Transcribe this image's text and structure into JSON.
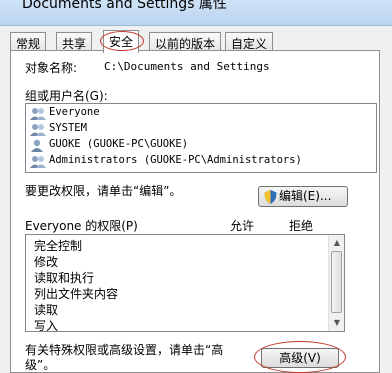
{
  "window": {
    "title": "Documents and Settings 属性"
  },
  "tabs": [
    {
      "label": "常规"
    },
    {
      "label": "共享"
    },
    {
      "label": "安全",
      "active": true
    },
    {
      "label": "以前的版本"
    },
    {
      "label": "自定义"
    }
  ],
  "security": {
    "object_name_label": "对象名称:",
    "object_name_value": "C:\\Documents and Settings",
    "groups_label": "组或用户名(G):",
    "users": [
      {
        "name": "Everyone",
        "icon": "users-group-icon"
      },
      {
        "name": "SYSTEM",
        "icon": "users-group-icon"
      },
      {
        "name": "GUOKE (GUOKE-PC\\GUOKE)",
        "icon": "user-icon"
      },
      {
        "name": "Administrators (GUOKE-PC\\Administrators)",
        "icon": "users-group-icon"
      }
    ],
    "edit_hint": "要更改权限，请单击“编辑”。",
    "edit_button": "编辑(E)...",
    "permissions_for": "Everyone 的权限(P)",
    "col_allow": "允许",
    "col_deny": "拒绝",
    "permissions": [
      {
        "name": "完全控制"
      },
      {
        "name": "修改"
      },
      {
        "name": "读取和执行"
      },
      {
        "name": "列出文件夹内容"
      },
      {
        "name": "读取"
      },
      {
        "name": "写入"
      }
    ],
    "advanced_hint_line1": "有关特殊权限或高级设置，请单击“高",
    "advanced_hint_line2": "级”。",
    "advanced_button": "高级(V)"
  },
  "colors": {
    "highlight_oval": "#c0392b",
    "shield_accent": "#2f6fb7"
  }
}
